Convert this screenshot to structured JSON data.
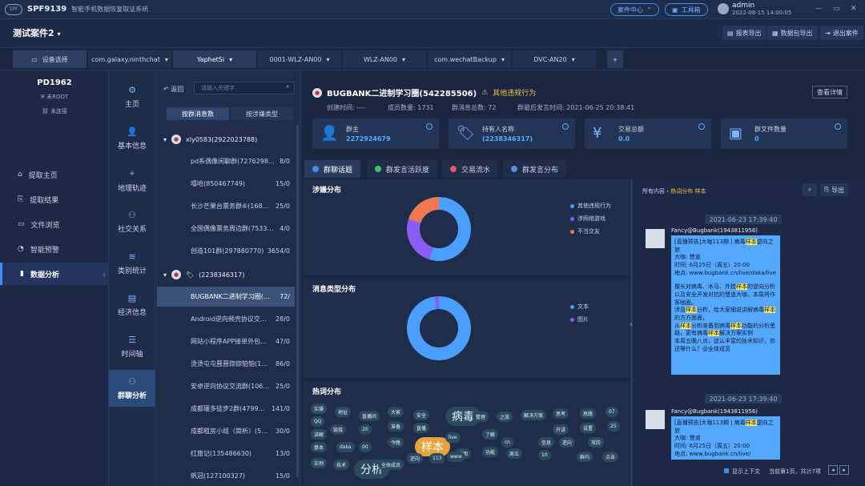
{
  "app": {
    "name": "SPF9139",
    "subtitle": "智能手机数据恢复取证系统",
    "logo_text": "SPF"
  },
  "titlebar": {
    "case_center": "案件中心",
    "toolbox": "工具箱",
    "user": "admin",
    "datetime": "2022-08-15 14:00:05",
    "min": "—",
    "max": "▭",
    "close": "✕"
  },
  "case": {
    "title": "测试案件2",
    "export_report": "报表导出",
    "export_package": "数据包导出",
    "exit_case": "退出案件"
  },
  "device_tabs": [
    {
      "label": "设备选择"
    },
    {
      "label": "com.galaxy.ninthchat"
    },
    {
      "label": "YaphetSi"
    },
    {
      "label": "0001-WLZ-AN00"
    },
    {
      "label": "WLZ-AN00"
    },
    {
      "label": "com.wechatBackup"
    },
    {
      "label": "DVC-AN20"
    }
  ],
  "device": {
    "name": "PD1962",
    "root": "未ROOT",
    "connection": "未连接"
  },
  "leftnav": [
    {
      "label": "提取主页"
    },
    {
      "label": "提取结果"
    },
    {
      "label": "文件浏览"
    },
    {
      "label": "智能预警"
    },
    {
      "label": "数据分析"
    }
  ],
  "midnav": [
    {
      "label": "主页",
      "icon": "⚙"
    },
    {
      "label": "基本信息",
      "icon": "👤"
    },
    {
      "label": "地理轨迹",
      "icon": "⌖"
    },
    {
      "label": "社交关系",
      "icon": "⚇"
    },
    {
      "label": "类别统计",
      "icon": "≋"
    },
    {
      "label": "经济信息",
      "icon": "▤"
    },
    {
      "label": "时间轴",
      "icon": "☰"
    },
    {
      "label": "群聊分析",
      "icon": "⚇"
    }
  ],
  "listpanel": {
    "back": "返回",
    "search_placeholder": "请输入关键字",
    "seg_by_msg": "按群消息数",
    "seg_by_type": "按涉嫌类型",
    "group1": {
      "title": "xly0583(2922023788)"
    },
    "items1": [
      {
        "name": "pd系偶像闲聊群(7276298…",
        "count": "8/0"
      },
      {
        "name": "嘻哈(850467749)",
        "count": "15/0"
      },
      {
        "name": "长沙芒果台票务群⑥(168…",
        "count": "25/0"
      },
      {
        "name": "全国偶像票务周边群(7533…",
        "count": "4/0"
      },
      {
        "name": "创造101群(297880770)",
        "count": "3654/0"
      }
    ],
    "group2": {
      "title": "(2238346317)"
    },
    "items2": [
      {
        "name": "BUGBANK二进制学习圈(…",
        "count": "72/"
      },
      {
        "name": "Android逆向频壳协议交…",
        "count": "28/0"
      },
      {
        "name": "网站小程序APP接单外包…",
        "count": "47/0"
      },
      {
        "name": "烫烫屯屯葺葺锪锪铂铂(1…",
        "count": "86/0"
      },
      {
        "name": "安卓逆向协议交流群(106…",
        "count": "25/0"
      },
      {
        "name": "成都瓘多徒步2群(4799…",
        "count": "141/0"
      },
      {
        "name": "成都租房小组（简析）(5…",
        "count": "30/0"
      },
      {
        "name": "红旅记(135486630)",
        "count": "13/0"
      },
      {
        "name": "帆冠(127100327)",
        "count": "15/0"
      }
    ]
  },
  "group": {
    "title": "BUGBANK二进制学习圈(542285506)",
    "warning": "其他违规行为",
    "detail_button": "查看详情",
    "created": "创建时间: ----",
    "members": "成员数量: 1731",
    "total_msgs": "群消息总数: 72",
    "last_msg": "群最后发言时间: 2021-06-25 20:38:41"
  },
  "cards": [
    {
      "label": "群主",
      "value": "2272924679",
      "icon": "👤"
    },
    {
      "label": "持有人名称",
      "value": "(2238346317)",
      "icon": "🏷"
    },
    {
      "label": "交易总额",
      "value": "0.0",
      "icon": "¥"
    },
    {
      "label": "群文件数量",
      "value": "0",
      "icon": "▣"
    }
  ],
  "view_tabs": [
    {
      "label": "群聊话题",
      "color": "#3d8ef0"
    },
    {
      "label": "群发言活跃度",
      "color": "#3cc76a"
    },
    {
      "label": "交易流水",
      "color": "#e05a6a"
    },
    {
      "label": "群发言分布",
      "color": "#5a8fe0"
    }
  ],
  "sections": {
    "involved": "涉嫌分布",
    "msgtype": "消息类型分布",
    "hotwords": "热词分布"
  },
  "chart_data": [
    {
      "type": "pie",
      "title": "涉嫌分布",
      "categories": [
        "其他违规行为",
        "涉网络游戏",
        "不当交友"
      ],
      "values": [
        55,
        25,
        20
      ],
      "colors": [
        "#4a9eff",
        "#8a5cf6",
        "#f07850"
      ]
    },
    {
      "type": "pie",
      "title": "消息类型分布",
      "categories": [
        "文本",
        "图片"
      ],
      "values": [
        98,
        2
      ],
      "colors": [
        "#4a9eff",
        "#8a5cf6"
      ]
    }
  ],
  "hotwords": [
    "实操",
    "地址",
    "直播间",
    "大家",
    "安全",
    "病毒",
    "整理",
    "之旅",
    "解决方案",
    "思考",
    "思路",
    "07",
    "QQ",
    "链接",
    "20",
    "准备",
    "直播",
    "开讲",
    "设置",
    "25",
    "讲解",
    "今晚",
    "样本",
    "live",
    "了解",
    "cn",
    "信息",
    "逆向",
    "攻防",
    "基本",
    "daka",
    "00",
    "逆向",
    "113",
    "看图",
    "功能",
    "周五",
    "10",
    "群内",
    "点击",
    "实例",
    "技术",
    "分析",
    "全体成员",
    "www"
  ],
  "chat": {
    "crumb_prefix": "所有内容 › ",
    "crumb_current": "热词分布 样本",
    "export": "导出",
    "search_icon": "⌕",
    "time1": "2021-06-23 17:39:40",
    "sender1": "Fancy@Bugbank(1943811956)",
    "msg_lines1": [
      "[直播预告]大咖113期 | 病毒样本逆向之旅",
      "大咖: 慧道",
      "时间: 6月25日（周五）20:00",
      "地点: www.bugbank.cn/live/daka/live"
    ],
    "msg_body1": [
      "擅长对病毒、木马、外挂样本的逆向分析以及安全开发对抗的慧道大咖，本周将作客咖面。",
      "涉及样本分析，给大家细说讲解病毒样本的方方面面，",
      "从样本分析准备到病毒样本功能的分析思路，更有病毒样本解决方案实例",
      "本周五晚八点，这么丰富的技术知识，你还等什么？@全体成员"
    ],
    "time2": "2021-06-23 17:39:40",
    "sender2": "Fancy@Bugbank(1943811956)",
    "msg_lines2": [
      "[直播预告]大咖113期 | 病毒样本逆向之旅",
      "大咖: 慧道",
      "时间: 6月25日（周五）20:00",
      "地点: www.bugbank.cn/live/"
    ],
    "context_label": "显示上下文",
    "page_info": "当前第1页，共计7项"
  }
}
